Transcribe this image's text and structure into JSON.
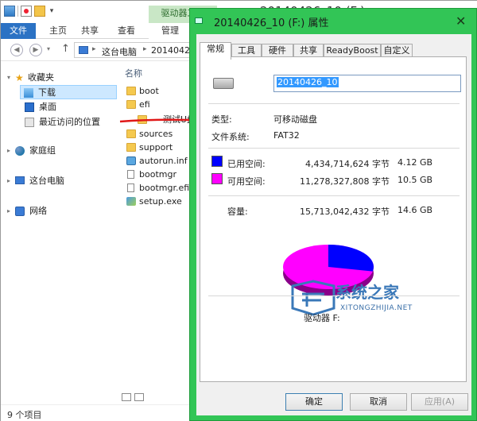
{
  "explorer": {
    "title": "20140426_10 (F:)",
    "contextual_tab_group": "驱动器工具",
    "ribbon_tabs": [
      "文件",
      "主页",
      "共享",
      "查看",
      "管理"
    ],
    "address": {
      "crumbs": [
        "这台电脑",
        "20140426_"
      ]
    },
    "nav": {
      "favorites": "收藏夹",
      "downloads": "下载",
      "desktop": "桌面",
      "recent": "最近访问的位置",
      "homegroup": "家庭组",
      "this_pc": "这台电脑",
      "network": "网络"
    },
    "column_header": "名称",
    "files": [
      "boot",
      "efi",
      "测试U盘",
      "sources",
      "support",
      "autorun.inf",
      "bootmgr",
      "bootmgr.efi",
      "setup.exe"
    ],
    "status": "9 个项目"
  },
  "dialog": {
    "title": "20140426_10 (F:) 属性",
    "close_glyph": "✕",
    "tabs": [
      "常规",
      "工具",
      "硬件",
      "共享",
      "ReadyBoost",
      "自定义"
    ],
    "active_tab": "常规",
    "volume_name": "20140426_10",
    "type_label": "类型:",
    "type_value": "可移动磁盘",
    "fs_label": "文件系统:",
    "fs_value": "FAT32",
    "used_label": "已用空间:",
    "used_bytes": "4,434,714,624 字节",
    "used_size": "4.12 GB",
    "free_label": "可用空间:",
    "free_bytes": "11,278,327,808 字节",
    "free_size": "10.5 GB",
    "capacity_label": "容量:",
    "capacity_bytes": "15,713,042,432 字节",
    "capacity_size": "14.6 GB",
    "drive_caption": "驱动器 F:",
    "buttons": {
      "ok": "确定",
      "cancel": "取消",
      "apply": "应用(A)"
    },
    "colors": {
      "used": "#0000ff",
      "free": "#ff00ff",
      "frame": "#32c556"
    }
  },
  "watermark": {
    "main": "系统之家",
    "sub": "XITONGZHIJIA.NET"
  },
  "chart_data": {
    "type": "pie",
    "categories": [
      "已用空间",
      "可用空间"
    ],
    "values": [
      4434714624,
      11278327808
    ],
    "colors": [
      "#0000ff",
      "#ff00ff"
    ]
  }
}
